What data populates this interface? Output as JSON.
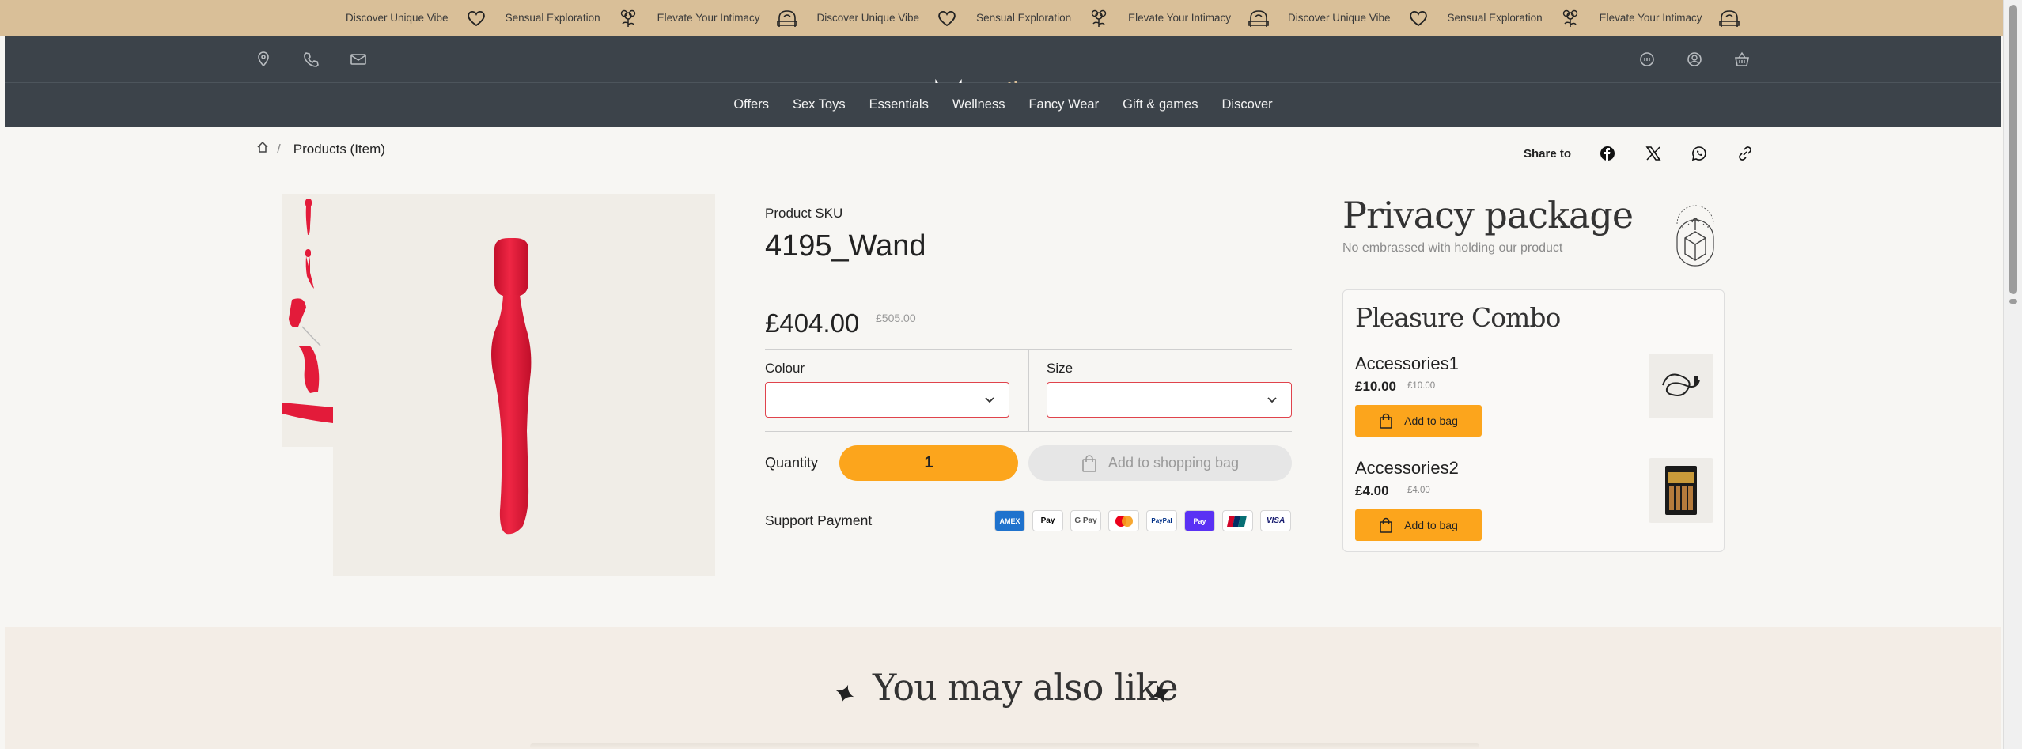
{
  "ticker": {
    "items": [
      {
        "text": "Discover Unique Vibe",
        "icon": "heart-icon"
      },
      {
        "text": "Sensual Exploration",
        "icon": "flower-icon"
      },
      {
        "text": "Elevate Your Intimacy",
        "icon": "bed-icon"
      },
      {
        "text": "Discover Unique Vibe",
        "icon": "heart-icon"
      },
      {
        "text": "Sensual Exploration",
        "icon": "flower-icon"
      },
      {
        "text": "Elevate Your Intimacy",
        "icon": "bed-icon"
      },
      {
        "text": "Discover Unique Vibe",
        "icon": "heart-icon"
      },
      {
        "text": "Sensual Exploration",
        "icon": "flower-icon"
      },
      {
        "text": "Elevate Your Intimacy",
        "icon": "bed-icon"
      }
    ]
  },
  "header": {
    "logo_text": "MEVIBE",
    "left_icons": [
      "location-icon",
      "phone-icon",
      "mail-icon"
    ],
    "right_icons": [
      "chat-icon",
      "account-icon",
      "basket-icon"
    ]
  },
  "nav": {
    "items": [
      "Offers",
      "Sex Toys",
      "Essentials",
      "Wellness",
      "Fancy Wear",
      "Gift & games",
      "Discover"
    ]
  },
  "breadcrumb": {
    "separator": "/",
    "current": "Products (Item)"
  },
  "share": {
    "label": "Share to",
    "icons": [
      "facebook-icon",
      "x-icon",
      "whatsapp-icon",
      "link-icon"
    ]
  },
  "product": {
    "sku_label": "Product SKU",
    "sku": "4195_Wand",
    "price": "£404.00",
    "old_price": "£505.00",
    "colour_label": "Colour",
    "colour_value": "",
    "size_label": "Size",
    "size_value": "",
    "quantity_label": "Quantity",
    "quantity": "1",
    "add_to_bag": "Add to shopping bag",
    "payment_label": "Support Payment",
    "payment_methods": [
      "AMEX",
      "Apple Pay",
      "G Pay",
      "Mastercard",
      "PayPal",
      "Shop Pay",
      "UnionPay",
      "VISA"
    ],
    "color_accent": "#fca51c",
    "color_product": "#e31b3a"
  },
  "privacy": {
    "title": "Privacy package",
    "subtitle": "No embrassed with holding our product"
  },
  "combo": {
    "title": "Pleasure Combo",
    "items": [
      {
        "name": "Accessories1",
        "price": "£10.00",
        "old_price": "£10.00",
        "button": "Add to bag"
      },
      {
        "name": "Accessories2",
        "price": "£4.00",
        "old_price": "£4.00",
        "button": "Add to bag"
      }
    ]
  },
  "recommend": {
    "title": "You may also like"
  }
}
